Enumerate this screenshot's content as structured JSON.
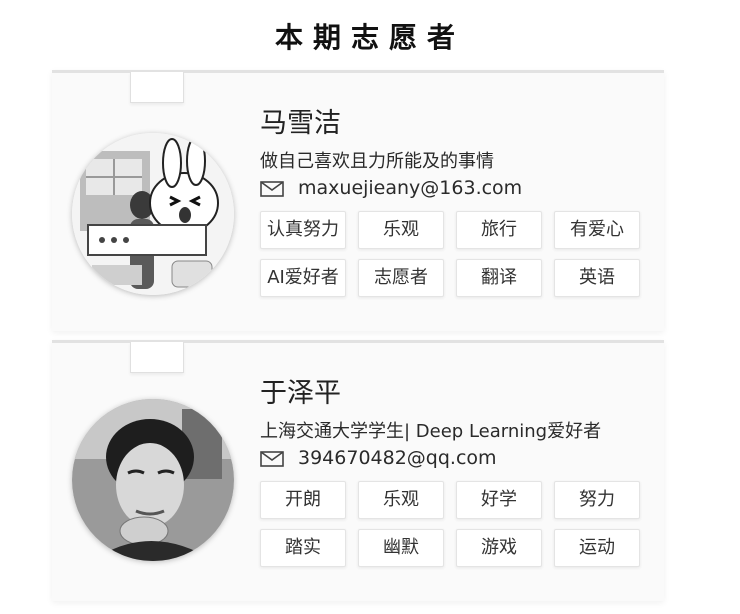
{
  "page_title": "本期志愿者",
  "volunteers": [
    {
      "name": "马雪洁",
      "tagline": "做自己喜欢且力所能及的事情",
      "email": "maxuejieany@163.com",
      "tags": [
        "认真努力",
        "乐观",
        "旅行",
        "有爱心",
        "AI爱好者",
        "志愿者",
        "翻译",
        "英语"
      ]
    },
    {
      "name": "于泽平",
      "tagline": "上海交通大学学生| Deep Learning爱好者",
      "email": "394670482@qq.com",
      "tags": [
        "开朗",
        "乐观",
        "好学",
        "努力",
        "踏实",
        "幽默",
        "游戏",
        "运动"
      ]
    }
  ],
  "icons": {
    "mail": "mail-icon"
  },
  "colors": {
    "background": "#ffffff",
    "card": "#fafafa",
    "tag_border": "#e4e4e4",
    "text": "#222222"
  }
}
